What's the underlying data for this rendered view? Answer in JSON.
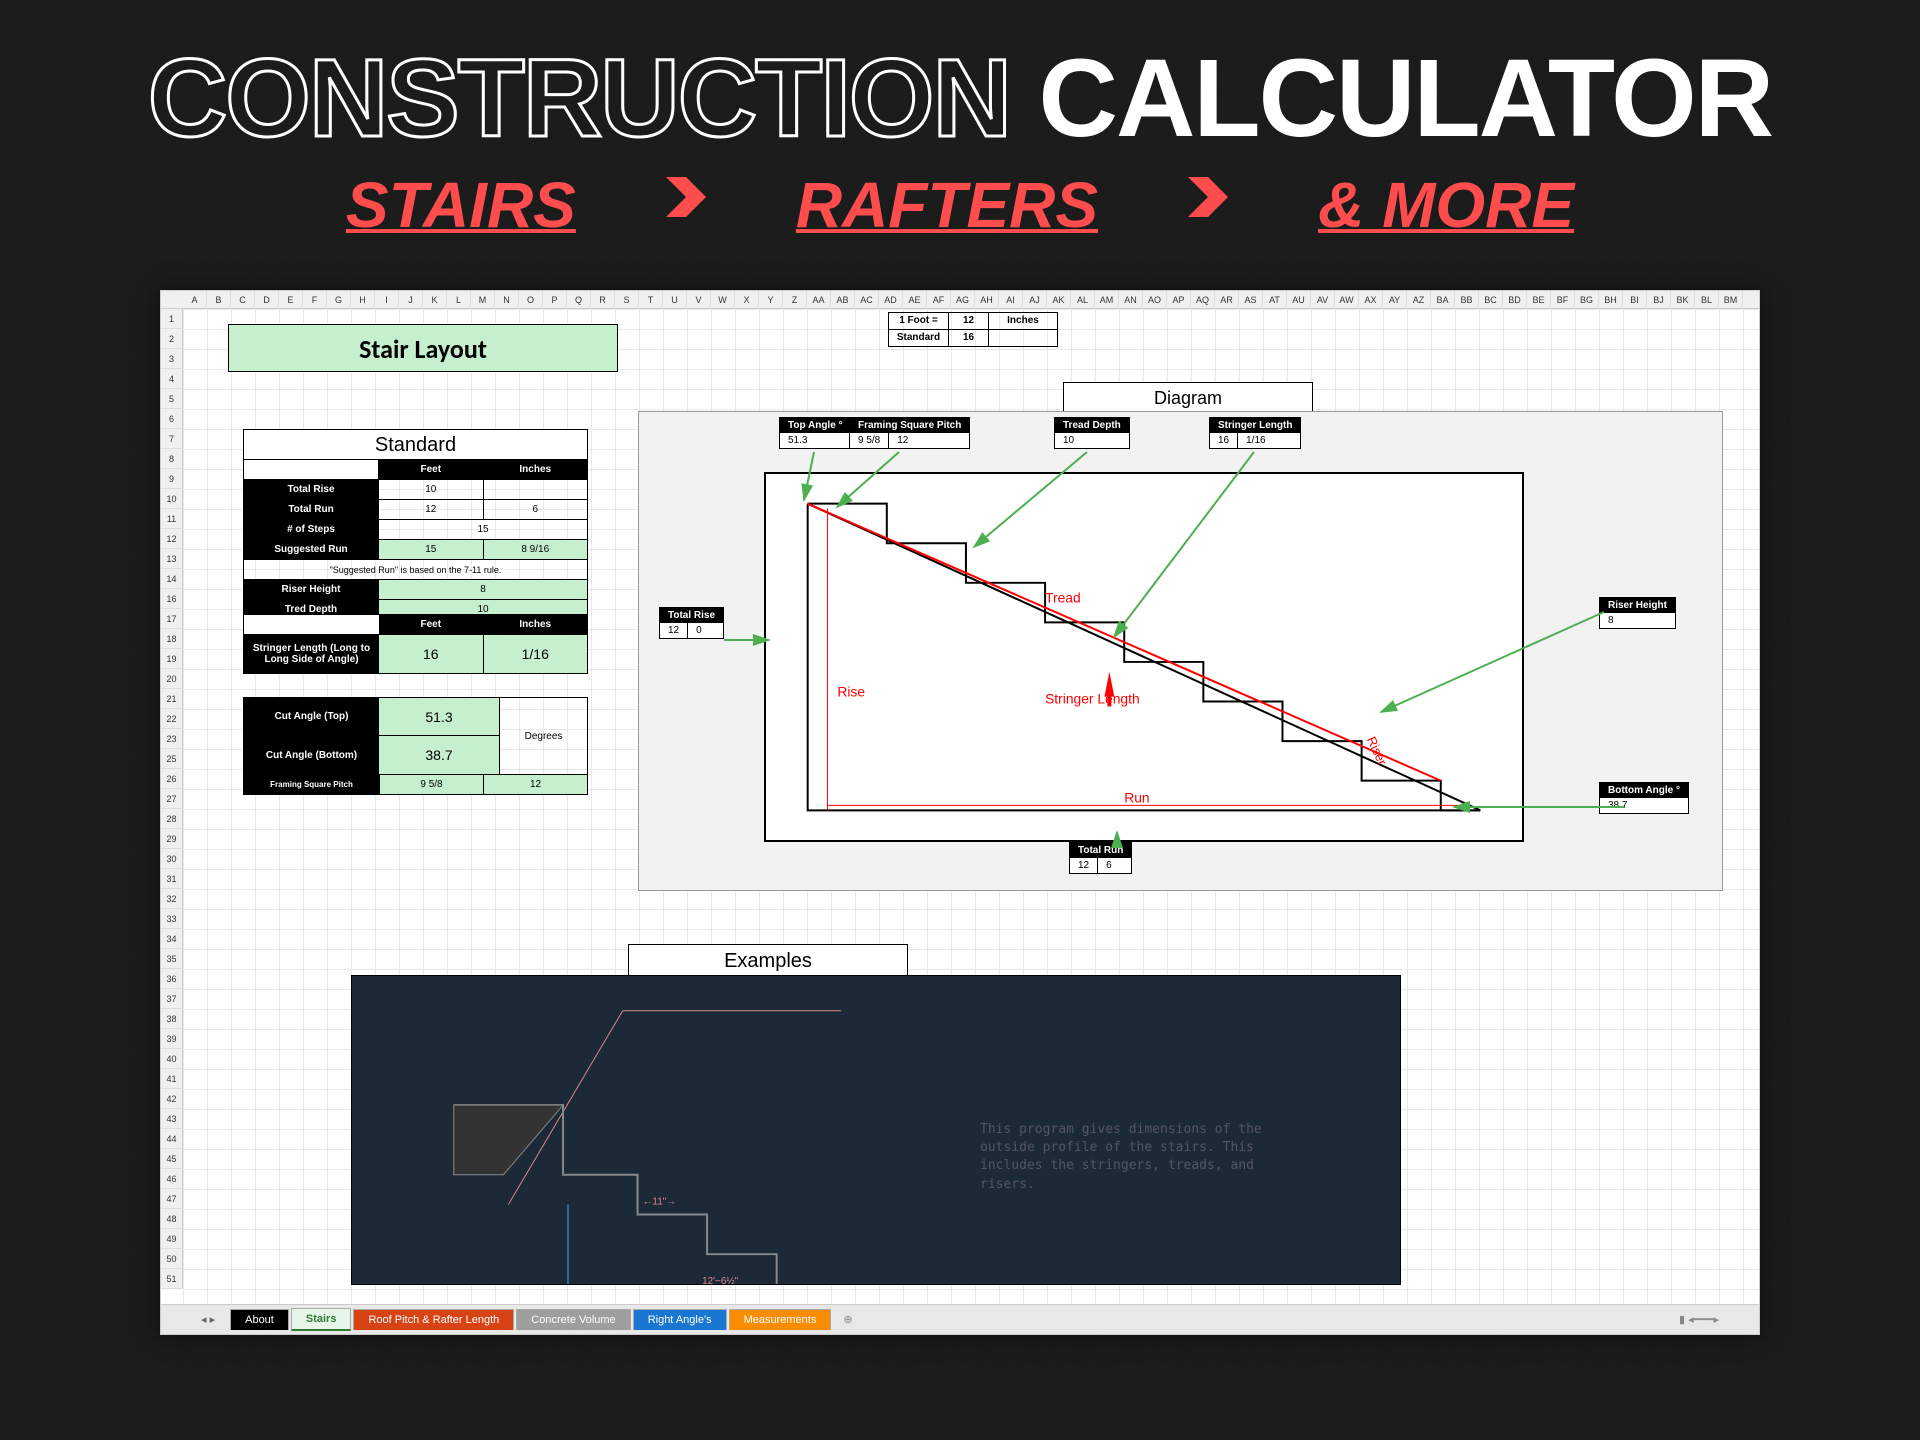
{
  "header": {
    "title_outline": "CONSTRUCTION",
    "title_solid": "CALCULATOR",
    "sub1": "STAIRS",
    "sub2": "RAFTERS",
    "sub3": "& MORE"
  },
  "sheet": {
    "title": "Stair Layout",
    "info": {
      "foot_label": "1 Foot =",
      "foot_val": "12",
      "foot_unit": "Inches",
      "standard_label": "Standard",
      "standard_val": "16"
    },
    "diagram_label": "Diagram",
    "examples_label": "Examples",
    "examples_text": "This program gives dimensions of the outside profile of the stairs. This includes the stringers, treads, and risers.",
    "standard": {
      "header": "Standard",
      "feet": "Feet",
      "inches": "Inches",
      "total_rise_label": "Total Rise",
      "total_rise_ft": "10",
      "total_rise_in": "",
      "total_run_label": "Total Run",
      "total_run_ft": "12",
      "total_run_in": "6",
      "steps_label": "# of Steps",
      "steps_val": "15",
      "suggested_label": "Suggested Run",
      "suggested_ft": "15",
      "suggested_in": "8   9/16",
      "note": "\"Suggested Run\" is based on the 7-11 rule.",
      "riser_label": "Riser Height",
      "riser_val": "8",
      "tread_label": "Tred Depth",
      "tread_val": "10"
    },
    "stringer": {
      "label": "Stringer Length (Long to Long Side of Angle)",
      "feet_h": "Feet",
      "inches_h": "Inches",
      "feet": "16",
      "inches": "1/16"
    },
    "cuts": {
      "top_label": "Cut Angle (Top)",
      "top_val": "51.3",
      "bottom_label": "Cut Angle (Bottom)",
      "bottom_val": "38.7",
      "degrees": "Degrees",
      "fs_label": "Framing Square Pitch",
      "fs_v1": "9   5/8",
      "fs_v2": "12"
    },
    "callouts": {
      "top_angle_h": "Top Angle °",
      "top_angle_v": "51.3",
      "fs_pitch_h": "Framing Square Pitch",
      "fs_pitch_v1": "9   5/8",
      "fs_pitch_v2": "12",
      "tread_h": "Tread Depth",
      "tread_v": "10",
      "stringer_h": "Stringer Length",
      "stringer_v1": "16",
      "stringer_v2": "1/16",
      "total_rise_h": "Total Rise",
      "total_rise_v1": "12",
      "total_rise_v2": "0",
      "riser_h": "Riser Height",
      "riser_v": "8",
      "bottom_angle_h": "Bottom Angle °",
      "bottom_angle_v": "38.7",
      "total_run_h": "Total Run",
      "total_run_v1": "12",
      "total_run_v2": "6"
    },
    "drawing": {
      "tread": "Tread",
      "rise": "Rise",
      "riser": "Riser",
      "run": "Run",
      "stringer_length": "Stringer Length"
    }
  },
  "tabs": {
    "about": "About",
    "stairs": "Stairs",
    "roof": "Roof Pitch & Rafter Length",
    "concrete": "Concrete Volume",
    "angles": "Right Angle's",
    "measurements": "Measurements"
  },
  "cols": [
    "A",
    "B",
    "C",
    "D",
    "E",
    "F",
    "G",
    "H",
    "I",
    "J",
    "K",
    "L",
    "M",
    "N",
    "O",
    "P",
    "Q",
    "R",
    "S",
    "T",
    "U",
    "V",
    "W",
    "X",
    "Y",
    "Z",
    "AA",
    "AB",
    "AC",
    "AD",
    "AE",
    "AF",
    "AG",
    "AH",
    "AI",
    "AJ",
    "AK",
    "AL",
    "AM",
    "AN",
    "AO",
    "AP",
    "AQ",
    "AR",
    "AS",
    "AT",
    "AU",
    "AV",
    "AW",
    "AX",
    "AY",
    "AZ",
    "BA",
    "BB",
    "BC",
    "BD",
    "BE",
    "BF",
    "BG",
    "BH",
    "BI",
    "BJ",
    "BK",
    "BL",
    "BM"
  ]
}
